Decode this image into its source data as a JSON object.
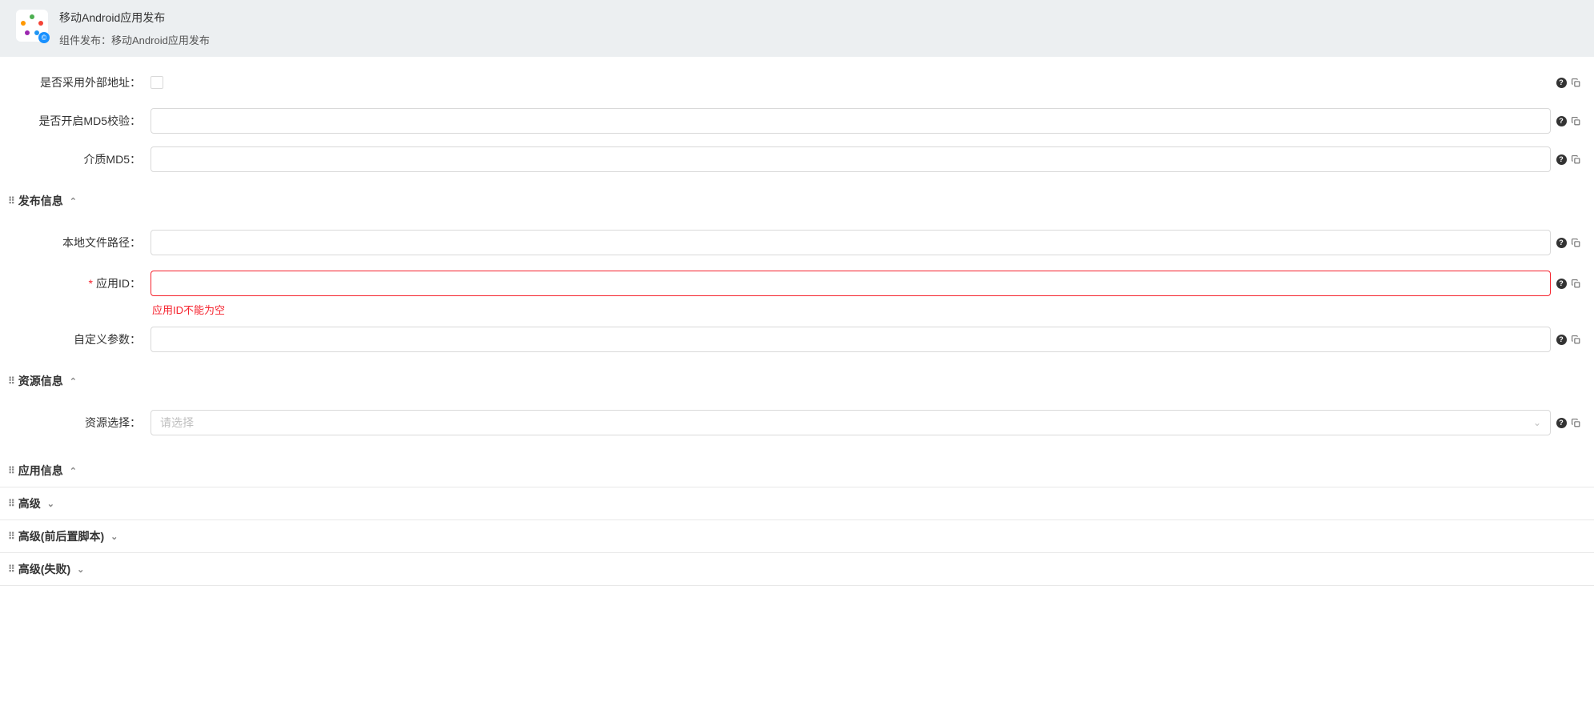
{
  "header": {
    "title": "移动Android应用发布",
    "subtitle_prefix": "组件发布：",
    "subtitle_value": "移动Android应用发布",
    "badge": "©"
  },
  "fields": {
    "external_addr": {
      "label": "是否采用外部地址：",
      "checked": false
    },
    "md5_check": {
      "label": "是否开启MD5校验：",
      "value": ""
    },
    "media_md5": {
      "label": "介质MD5：",
      "value": ""
    },
    "local_path": {
      "label": "本地文件路径：",
      "value": ""
    },
    "app_id": {
      "label": "应用ID：",
      "value": "",
      "error": "应用ID不能为空",
      "required": "*"
    },
    "custom_params": {
      "label": "自定义参数：",
      "value": ""
    },
    "resource_select": {
      "label": "资源选择：",
      "placeholder": "请选择"
    }
  },
  "sections": {
    "publish_info": "发布信息",
    "resource_info": "资源信息",
    "app_info": "应用信息",
    "advanced": "高级",
    "advanced_scripts": "高级(前后置脚本)",
    "advanced_failure": "高级(失败)"
  },
  "icons": {
    "help": "?",
    "drag": "⠿",
    "arrow_up": "⌃",
    "arrow_down": "⌄"
  }
}
